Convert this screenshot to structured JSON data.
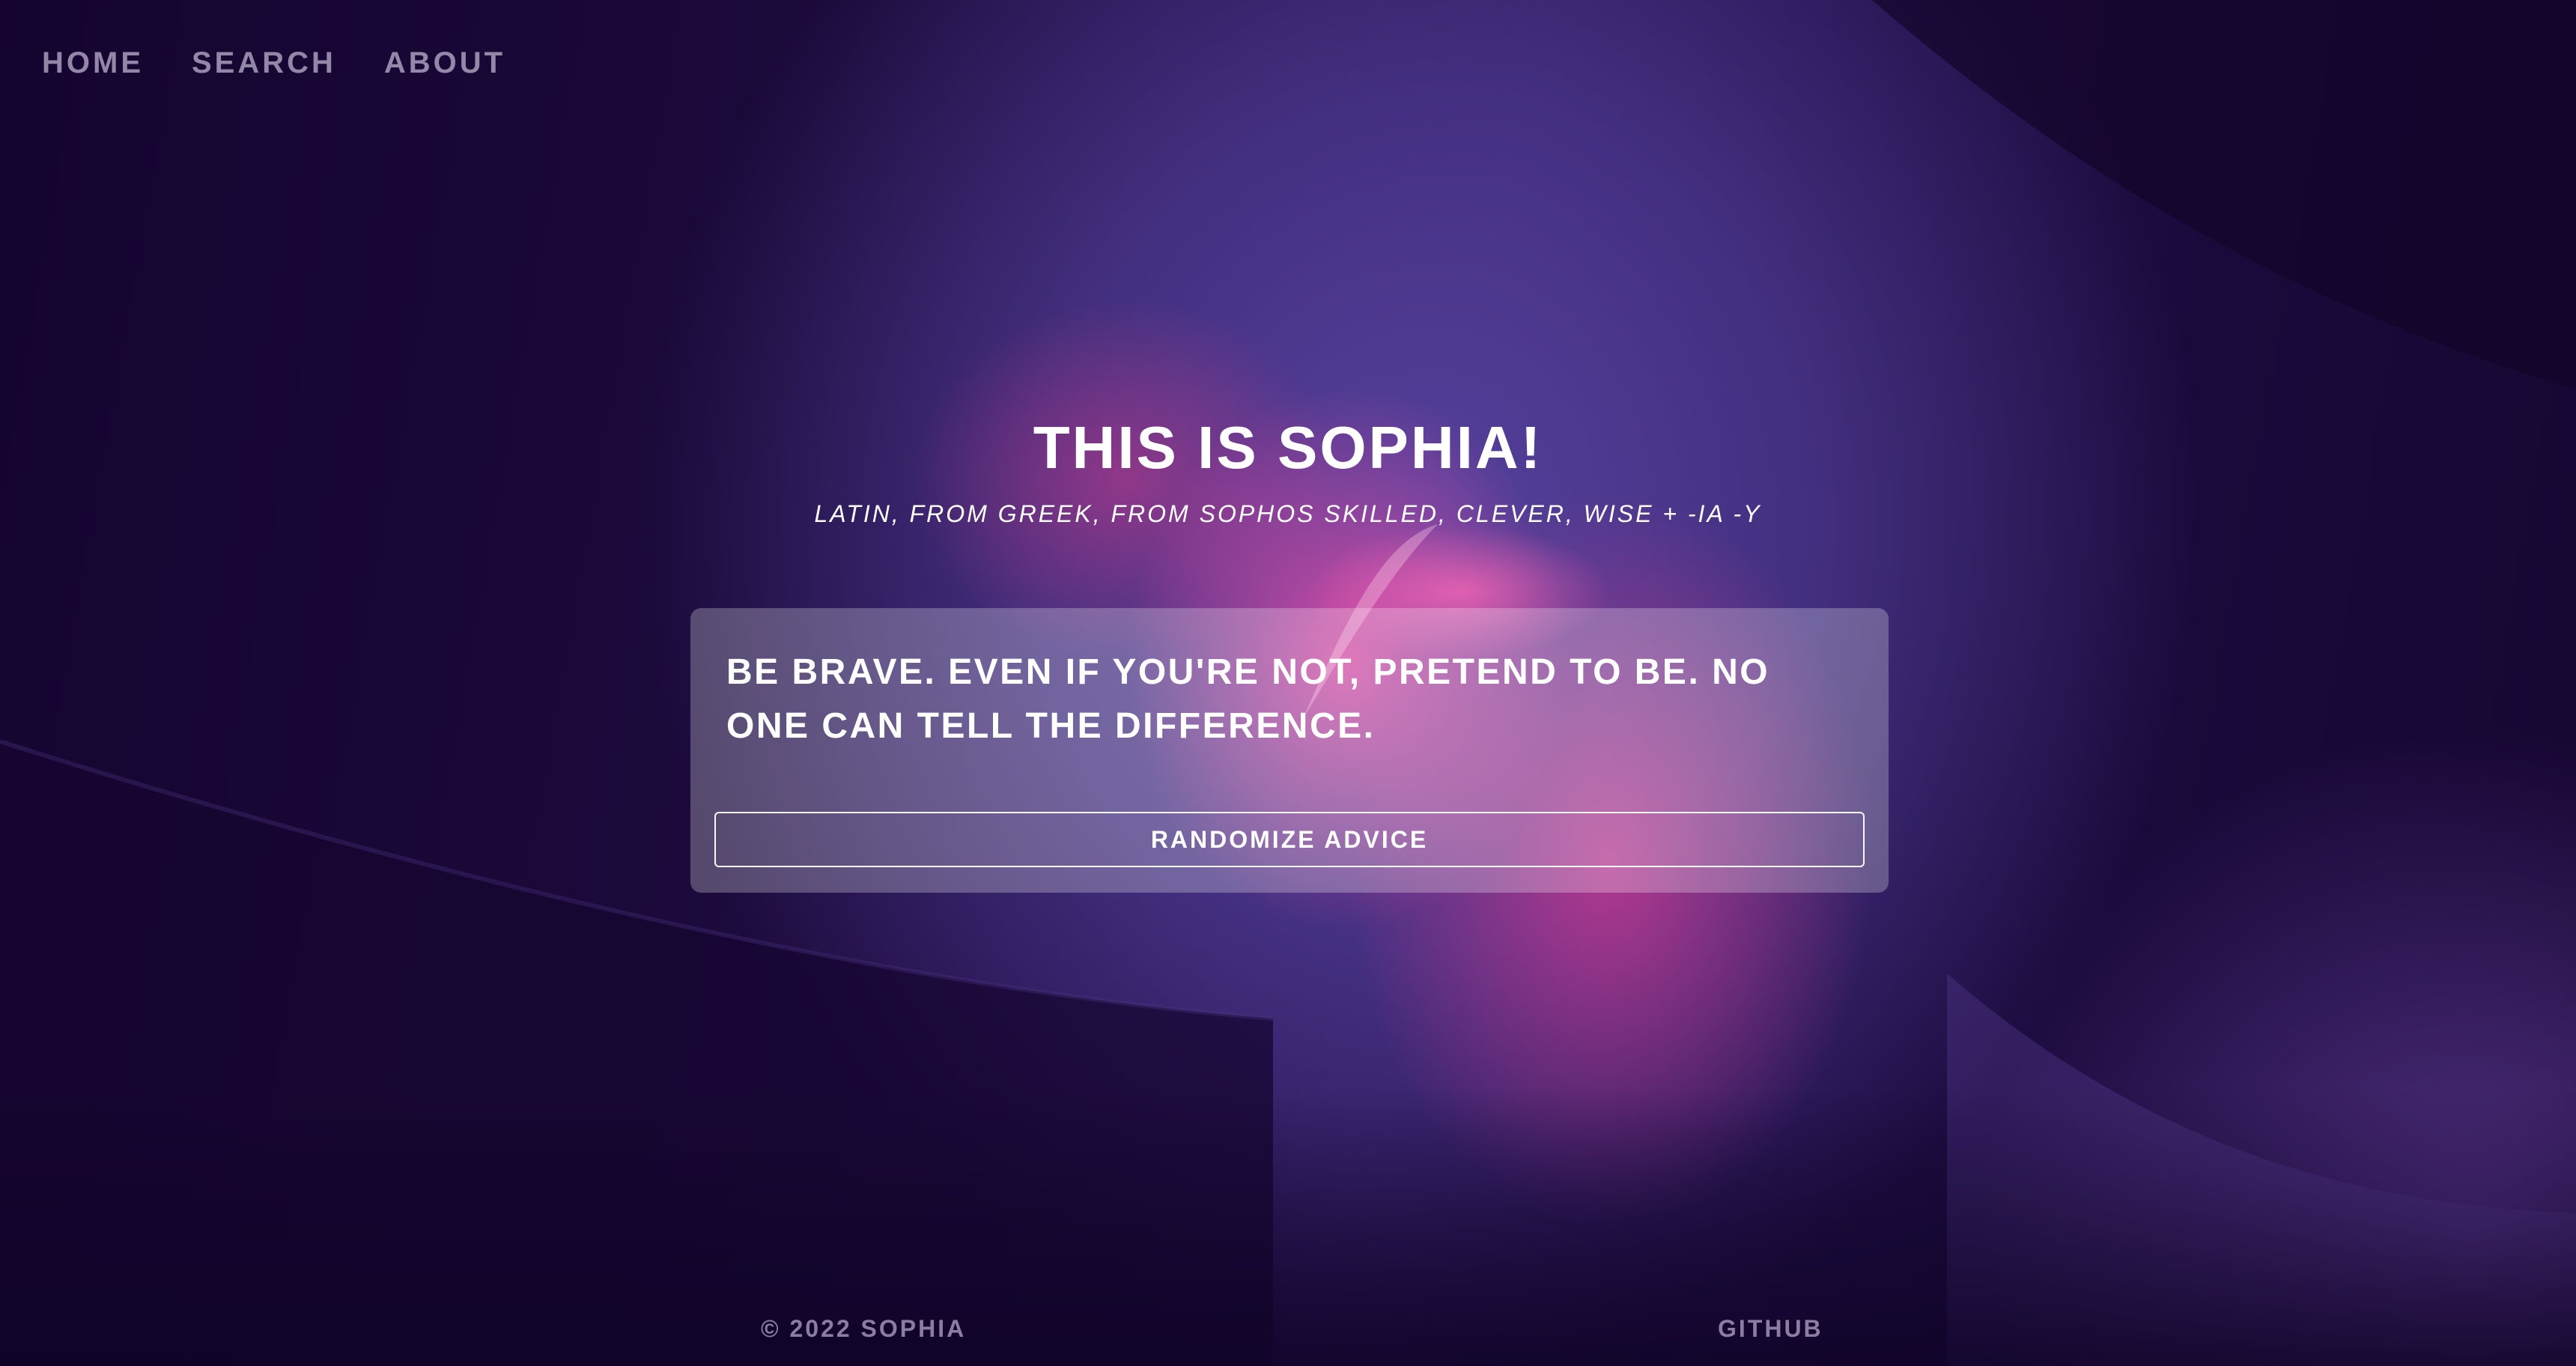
{
  "nav": {
    "items": [
      {
        "label": "HOME"
      },
      {
        "label": "SEARCH"
      },
      {
        "label": "ABOUT"
      }
    ]
  },
  "hero": {
    "title": "THIS IS SOPHIA!",
    "subtitle": "LATIN, FROM GREEK, FROM SOPHOS SKILLED, CLEVER, WISE + -IA -Y"
  },
  "advice": {
    "text": "BE BRAVE. EVEN IF YOU'RE NOT, PRETEND TO BE. NO ONE CAN TELL THE DIFFERENCE.",
    "button_label": "RANDOMIZE ADVICE"
  },
  "footer": {
    "copyright": "© 2022 SOPHIA",
    "github_label": "GITHUB"
  },
  "colors": {
    "background_dark": "#14062e",
    "accent_purple": "#574495",
    "accent_pink": "#ff50aa"
  }
}
